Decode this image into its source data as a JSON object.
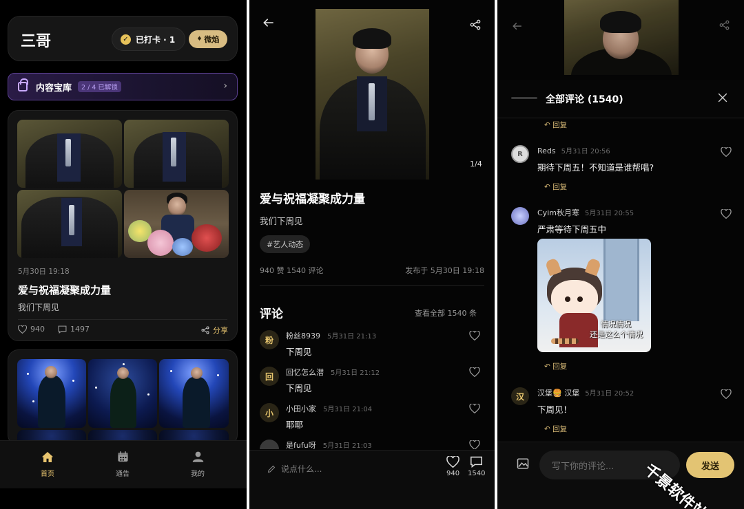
{
  "home": {
    "title": "三哥",
    "checkin_label": "已打卡 · 1",
    "weibo_label": "微焰",
    "vault": {
      "label": "内容宝库",
      "badge": "2 / 4 已解锁"
    },
    "post": {
      "date": "5月30日 19:18",
      "title": "爱与祝福凝聚成力量",
      "subtitle": "我们下周见",
      "likes": "940",
      "comments": "1497",
      "share_label": "分享"
    },
    "tabs": [
      {
        "label": "首页"
      },
      {
        "label": "通告"
      },
      {
        "label": "我的"
      }
    ],
    "accent": "#e8c46f"
  },
  "detail": {
    "page_indicator": "1/4",
    "title": "爱与祝福凝聚成力量",
    "subtitle": "我们下周见",
    "tag": "#艺人动态",
    "stats": "940 赞   1540 评论",
    "published": "发布于 5月30日 19:18",
    "comments_heading": "评论",
    "view_all": "查看全部 1540 条",
    "comments": [
      {
        "avatar": "粉",
        "name": "粉丝8939",
        "time": "5月31日 21:13",
        "text": "下周见"
      },
      {
        "avatar": "回",
        "name": "回忆怎么潜",
        "time": "5月31日 21:12",
        "text": "下周见"
      },
      {
        "avatar": "小",
        "name": "小田小家",
        "time": "5月31日 21:04",
        "text": "耶耶"
      },
      {
        "avatar": "",
        "name": "是fufu呀",
        "time": "5月31日 21:03",
        "text": ""
      }
    ],
    "input_placeholder": "说点什么...",
    "like_count": "940",
    "comment_count": "1540"
  },
  "sheet": {
    "title": "全部评论 (1540)",
    "reply_label": "回复",
    "comments": [
      {
        "avatar": "R",
        "name": "Reds",
        "time": "5月31日 20:56",
        "text": "期待下周五！不知道是谁帮唱?"
      },
      {
        "avatar": "",
        "name": "Cyim秋月寒",
        "time": "5月31日 20:55",
        "text": "严肃等待下周五中"
      },
      {
        "avatar": "汉",
        "name": "汉堡🍔 汉堡",
        "time": "5月31日 20:52",
        "text": "下周见！"
      }
    ],
    "sticker_caption_1": "情况情况",
    "sticker_caption_2": "还是这么个情况",
    "input_placeholder": "写下你的评论...",
    "send_label": "发送",
    "watermark": "千景软件站"
  }
}
